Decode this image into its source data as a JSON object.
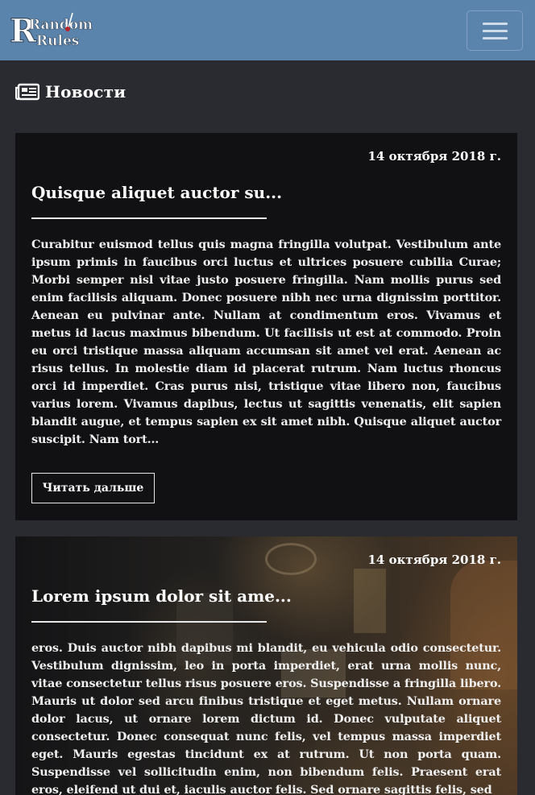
{
  "navbar": {
    "logo_text_line1": "Random",
    "logo_text_line2": "Rules",
    "logo_icon": "logo-icon",
    "menu_icon": "hamburger-menu-icon",
    "brand_color": "#5b84ad"
  },
  "page": {
    "heading": "Новости",
    "heading_icon": "newspaper-icon",
    "background_color": "#2a2b30"
  },
  "news": [
    {
      "date": "14 октября 2018 г.",
      "title": "Quisque aliquet auctor su...",
      "excerpt": "Curabitur euismod tellus quis magna fringilla volutpat. Vestibulum ante ipsum primis in faucibus orci luctus et ultrices posuere cubilia Curae; Morbi semper nisl vitae justo posuere fringilla. Nam mollis purus sed enim facilisis aliquam. Donec posuere nibh nec urna dignissim porttitor. Aenean eu pulvinar ante. Nullam at condimentum eros. Vivamus et metus id lacus maximus bibendum. Ut facilisis ut est at commodo. Proin eu orci tristique massa aliquam accumsan sit amet vel erat. Aenean ac risus tellus. In molestie diam id placerat rutrum. Nam luctus rhoncus orci id imperdiet. Cras purus nisi, tristique vitae libero non, faucibus varius lorem. Vivamus dapibus, lectus ut sagittis venenatis, elit sapien blandit augue, et tempus sapien ex sit amet nibh. Quisque aliquet auctor suscipit. Nam tort...",
      "read_more": "Читать дальше"
    },
    {
      "date": "14 октября 2018 г.",
      "title": "Lorem ipsum dolor sit ame...",
      "excerpt": "eros. Duis auctor nibh dapibus mi blandit, eu vehicula odio consectetur. Vestibulum dignissim, leo in porta imperdiet, erat urna mollis nunc, vitae consectetur tellus risus posuere eros. Suspendisse a fringilla libero. Mauris ut dolor sed arcu finibus tristique et eget metus. Nullam ornare dolor lacus, ut ornare lorem dictum id. Donec vulputate aliquet consectetur. Donec consequat nunc felis, vel tempus massa imperdiet eget. Mauris egestas tincidunt ex at rutrum. Ut non porta quam. Suspendisse vel sollicitudin enim, non bibendum felis. Praesent erat eros, eleifend ut dui et, iaculis auctor felis. Sed ornare sagittis felis, sed"
    }
  ]
}
